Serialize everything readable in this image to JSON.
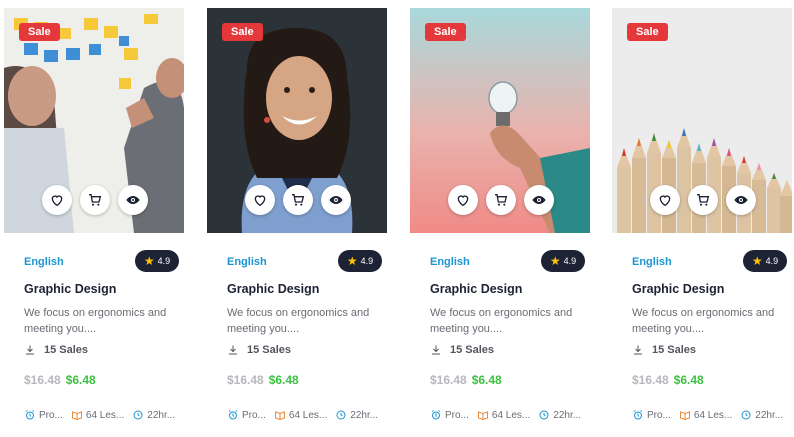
{
  "colors": {
    "sale_badge": "#e5383b",
    "category": "#1a96d4",
    "rating_bg": "#1e2235",
    "star": "#ffc107",
    "old_price": "#b7b7bd",
    "new_price": "#3ec13f"
  },
  "icons": [
    "heart-icon",
    "cart-icon",
    "eye-icon",
    "download-icon",
    "alarm-clock-icon",
    "book-icon",
    "clock-icon",
    "star-icon"
  ],
  "cards": [
    {
      "badge": "Sale",
      "category": "English",
      "rating": "4.9",
      "title": "Graphic Design",
      "description": "We focus on ergonomics and meeting you....",
      "sales": "15 Sales",
      "old_price": "$16.48",
      "new_price": "$6.48",
      "meta": [
        "Pro...",
        "64 Les...",
        "22hr..."
      ]
    },
    {
      "badge": "Sale",
      "category": "English",
      "rating": "4.9",
      "title": "Graphic Design",
      "description": "We focus on ergonomics and meeting you....",
      "sales": "15 Sales",
      "old_price": "$16.48",
      "new_price": "$6.48",
      "meta": [
        "Pro...",
        "64 Les...",
        "22hr..."
      ]
    },
    {
      "badge": "Sale",
      "category": "English",
      "rating": "4.9",
      "title": "Graphic Design",
      "description": "We focus on ergonomics and meeting you....",
      "sales": "15 Sales",
      "old_price": "$16.48",
      "new_price": "$6.48",
      "meta": [
        "Pro...",
        "64 Les...",
        "22hr..."
      ]
    },
    {
      "badge": "Sale",
      "category": "English",
      "rating": "4.9",
      "title": "Graphic Design",
      "description": "We focus on ergonomics and meeting you....",
      "sales": "15 Sales",
      "old_price": "$16.48",
      "new_price": "$6.48",
      "meta": [
        "Pro...",
        "64 Les...",
        "22hr..."
      ]
    }
  ]
}
